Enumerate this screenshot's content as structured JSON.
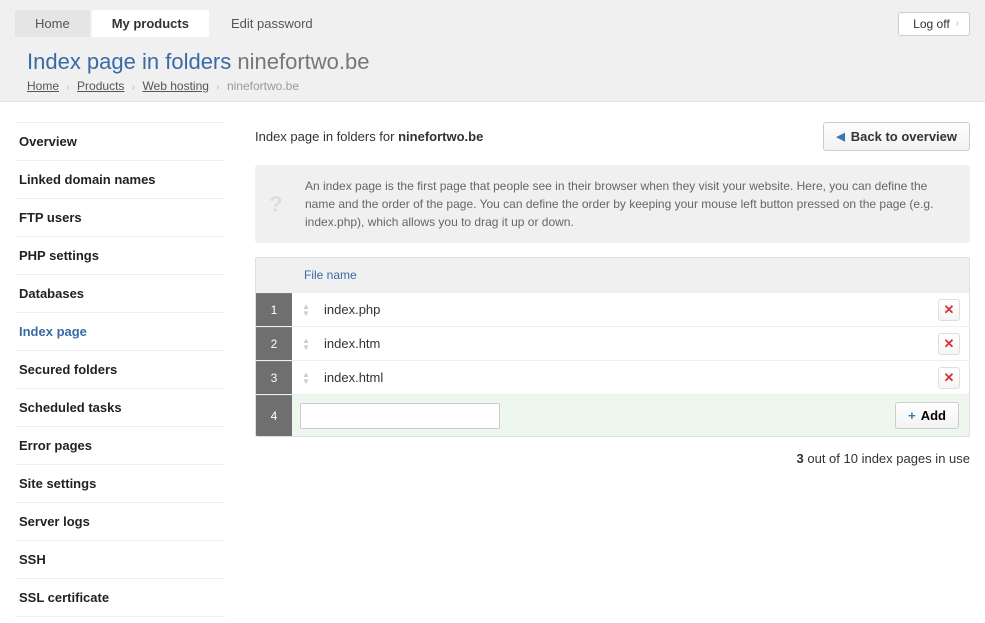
{
  "tabs": {
    "home": "Home",
    "products": "My products",
    "edit": "Edit password"
  },
  "logoff": "Log off",
  "page_title": {
    "blue": "Index page in folders",
    "grey": "ninefortwo.be"
  },
  "breadcrumb": {
    "home": "Home",
    "products": "Products",
    "hosting": "Web hosting",
    "current": "ninefortwo.be"
  },
  "sidebar": {
    "items": [
      "Overview",
      "Linked domain names",
      "FTP users",
      "PHP settings",
      "Databases",
      "Index page",
      "Secured folders",
      "Scheduled tasks",
      "Error pages",
      "Site settings",
      "Server logs",
      "SSH",
      "SSL certificate"
    ],
    "active_index": 5
  },
  "content": {
    "heading_prefix": "Index page in folders for ",
    "heading_domain": "ninefortwo.be",
    "back": "Back to overview",
    "info": "An index page is the first page that people see in their browser when they visit your website. Here, you can define the name and the order of the page. You can define the order by keeping your mouse left button pressed on the page (e.g. index.php), which allows you to drag it up or down.",
    "col_filename": "File name",
    "rows": [
      {
        "n": "1",
        "name": "index.php"
      },
      {
        "n": "2",
        "name": "index.htm"
      },
      {
        "n": "3",
        "name": "index.html"
      }
    ],
    "add_row_n": "4",
    "add_input_value": "",
    "add_label": "Add",
    "footer": {
      "count": "3",
      "text_rest": " out of 10 index pages in use"
    }
  }
}
